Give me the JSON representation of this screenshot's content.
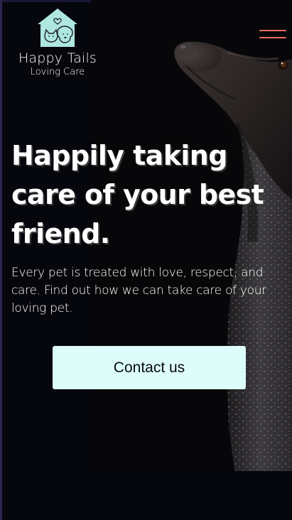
{
  "brand": {
    "name": "Happy Tails",
    "tagline": "Loving Care",
    "logo_icon": "pet-house-logo-icon",
    "logo_color": "#aee7e0"
  },
  "nav": {
    "menu_icon": "hamburger-menu-icon",
    "menu_color": "#e96b5f"
  },
  "hero": {
    "headline": "Happily taking care of your best friend.",
    "lead": "Every pet is treated with love, respect, and care. Find out how we can take care of your loving pet.",
    "cta_label": "Contact us",
    "cta_color": "#dcfdf9",
    "image": "dog-profile-photo"
  },
  "colors": {
    "background": "#06060d",
    "text": "#ffffff",
    "accent": "#e96b5f"
  }
}
